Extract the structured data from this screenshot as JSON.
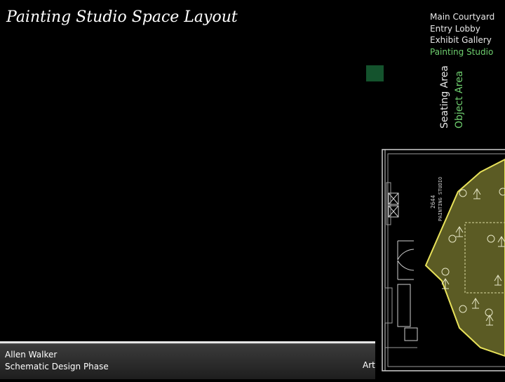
{
  "page": {
    "title": "Painting Studio Space Layout"
  },
  "nav": {
    "items": [
      {
        "label": "Main Courtyard",
        "active": false
      },
      {
        "label": "Entry Lobby",
        "active": false
      },
      {
        "label": "Exhibit Gallery",
        "active": false
      },
      {
        "label": "Painting Studio",
        "active": true
      }
    ]
  },
  "vertical_labels": {
    "seating": "Seating Area",
    "object": "Object Area"
  },
  "colors": {
    "seating_label": "#e8e8e8",
    "object_label": "#6fcf6f",
    "swatch": "#14532d",
    "floor_area": "#6b6b2a"
  },
  "footer": {
    "author": "Allen Walker",
    "phase": "Schematic Design Phase",
    "right_text": "Art"
  },
  "plan": {
    "room_label_line1": "2644",
    "room_label_line2": "PAINTING  STUDIO"
  }
}
